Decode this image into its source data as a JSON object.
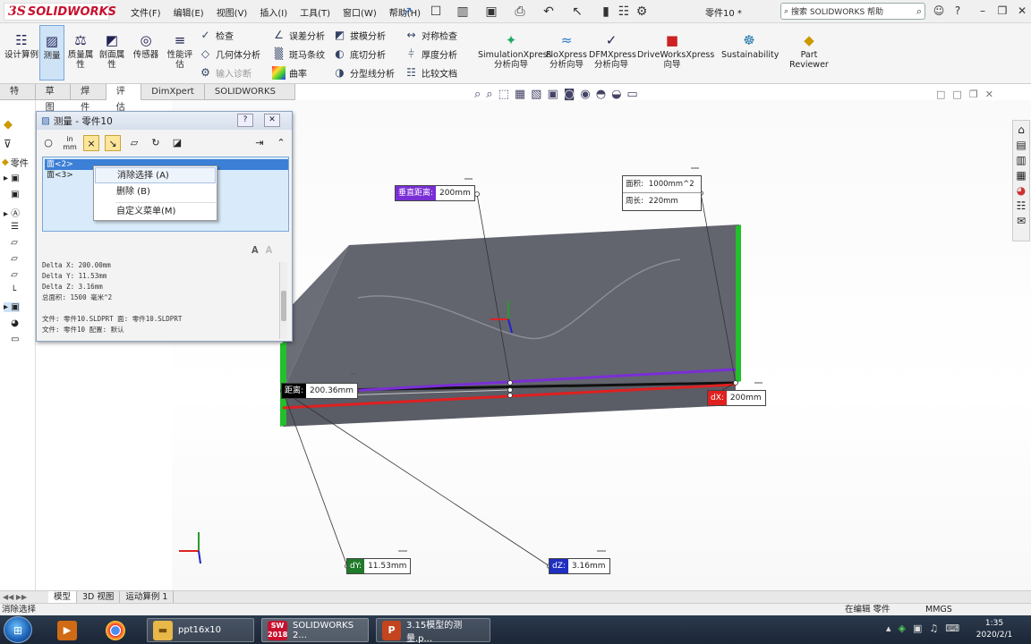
{
  "app": {
    "logo_text": "SOLIDWORKS",
    "logo_mark": "3S",
    "menus": [
      "文件(F)",
      "编辑(E)",
      "视图(V)",
      "插入(I)",
      "工具(T)",
      "窗口(W)",
      "帮助(H)"
    ],
    "doc_title": "零件10 *",
    "search_placeholder": "搜索 SOLIDWORKS 帮助"
  },
  "commandmanager": {
    "big_buttons": [
      {
        "label": "设计算例",
        "icon": "design-study-icon"
      },
      {
        "label": "测量",
        "icon": "measure-icon"
      },
      {
        "label": "质量属性",
        "icon": "mass-properties-icon"
      },
      {
        "label": "剖面属性",
        "icon": "section-properties-icon"
      },
      {
        "label": "传感器",
        "icon": "sensor-icon"
      },
      {
        "label": "性能评估",
        "icon": "performance-icon"
      }
    ],
    "col1": [
      "检查",
      "几何体分析",
      "输入诊断"
    ],
    "col2": [
      "误差分析",
      "斑马条纹",
      "曲率"
    ],
    "col3": [
      "拔模分析",
      "底切分析",
      "分型线分析"
    ],
    "col4": [
      "对称检查",
      "厚度分析",
      "比较文档"
    ],
    "xpress": [
      "SimulationXpress 分析向导",
      "FloXpress 分析向导",
      "DFMXpress 分析向导",
      "DriveWorksXpress 向导",
      "Sustainability",
      "Part Reviewer"
    ],
    "tabs": [
      "特征",
      "草图",
      "焊件",
      "评估",
      "DimXpert",
      "SOLIDWORKS MBD"
    ],
    "active_tab": "评估"
  },
  "tree": {
    "part_label": "零件"
  },
  "measure": {
    "title": "测量 - 零件10",
    "unit_label": "in\nmm",
    "selections": [
      "面<2>",
      "面<3>"
    ],
    "context_menu": [
      "消除选择 (A)",
      "删除 (B)",
      "自定义菜单(M)"
    ],
    "results": [
      "Delta X:  200.00mm",
      "Delta Y:  11.53mm",
      "Delta Z:  3.16mm",
      "总面积:  1500 毫米^2",
      "",
      "文件:   零件10.SLDPRT  面:   零件10.SLDPRT",
      "文件:   零件10 配置:   默认"
    ]
  },
  "callouts": {
    "vertical": {
      "label": "垂直距离:",
      "value": "200mm"
    },
    "area": {
      "label": "面积:",
      "value": "1000mm^2"
    },
    "perimeter": {
      "label": "周长:",
      "value": "220mm"
    },
    "distance": {
      "label": "距离:",
      "value": "200.36mm"
    },
    "dx": {
      "label": "dX:",
      "value": "200mm"
    },
    "dy": {
      "label": "dY:",
      "value": "11.53mm"
    },
    "dz": {
      "label": "dZ:",
      "value": "3.16mm"
    }
  },
  "bottom_tabs": [
    "模型",
    "3D 视图",
    "运动算例 1"
  ],
  "status": {
    "left": "消除选择",
    "mode": "在编辑 零件",
    "units": "MMGS"
  },
  "taskbar": {
    "apps": [
      {
        "label": "ppt16x10",
        "icon": "folder-icon"
      },
      {
        "label": "SOLIDWORKS 2...",
        "icon": "solidworks-icon"
      },
      {
        "label": "3.15模型的测量.p...",
        "icon": "powerpoint-icon"
      }
    ],
    "time": "1:35",
    "date": "2020/2/1",
    "sw_year": "2018"
  },
  "colors": {
    "accent_red": "#c8102e",
    "face_gray": "#62646e",
    "edge_green": "#22c02a",
    "vertical_purple": "#7a2ed6",
    "dx_red": "#e02020",
    "dy_green": "#1f7a2a",
    "dz_blue": "#1f2fc0"
  }
}
